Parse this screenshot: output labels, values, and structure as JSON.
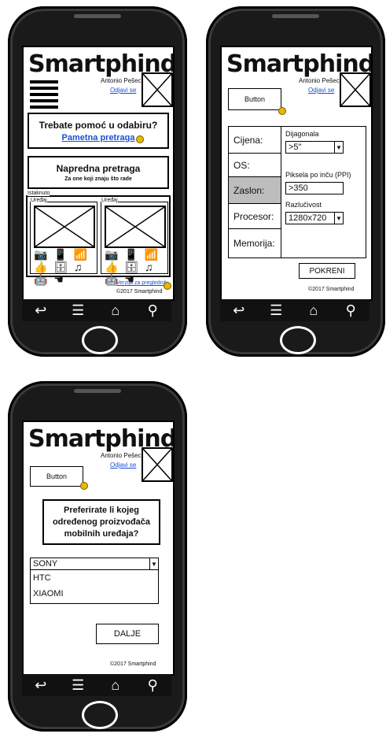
{
  "brand": "Smartphind",
  "author": "Antonio Pešec",
  "logout": "Odjavi se",
  "copyright": "©2017 Smartphind",
  "nav_icons": {
    "back": "back-icon",
    "menu": "menu-icon",
    "home": "home-icon",
    "search": "search-icon"
  },
  "screen1": {
    "help_title": "Trebate pomoć u odabiru?",
    "smart_search_link": "Pametna pretraga",
    "advanced_title": "Napredna pretraga",
    "advanced_sub": "Za one koji znaju što rade",
    "featured_label": "Istaknuto",
    "device_label": "Uređaj",
    "preview_link": "Verzija za preglednik",
    "feature_icons": "📷 📱 📶 👍 🗄 ♫ 🤖 ☚"
  },
  "screen2": {
    "button": "Button",
    "categories": [
      "Cijena:",
      "OS:",
      "Zaslon:",
      "Procesor:",
      "Memorija:"
    ],
    "selected_category": "Zaslon:",
    "diagonal_label": "Dijagonala",
    "diagonal_value": ">5\"",
    "ppi_label": "Piksela po inču (PPI)",
    "ppi_value": ">350",
    "resolution_label": "Razlučivost",
    "resolution_value": "1280x720",
    "run_button": "POKRENI"
  },
  "screen3": {
    "button": "Button",
    "question": "Preferirate li kojeg određenog proizvođača mobilnih uređaja?",
    "selected": "SONY",
    "options": [
      "HTC",
      "XIAOMI"
    ],
    "next_button": "DALJE"
  }
}
